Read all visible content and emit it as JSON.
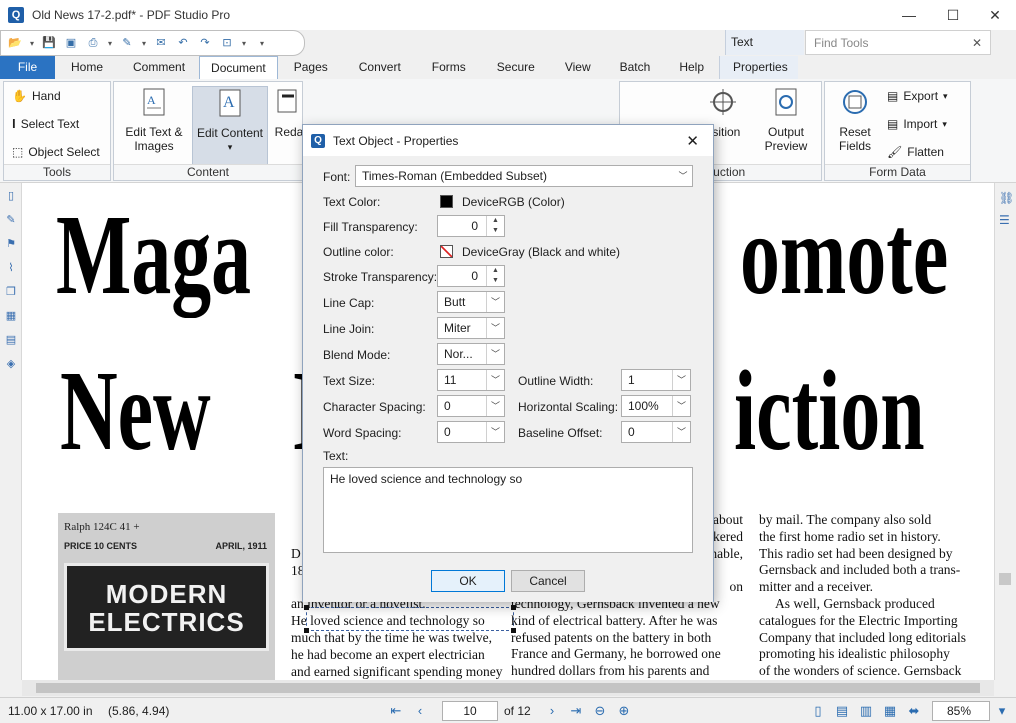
{
  "window": {
    "title": "Old News 17-2.pdf* - PDF Studio Pro",
    "logo_letter": "Q",
    "minimize": "—",
    "maximize": "☐",
    "close": "✕"
  },
  "context_tab_header": "Text",
  "find_tools": {
    "placeholder": "Find Tools",
    "clear": "✕"
  },
  "tabs": [
    "File",
    "Home",
    "Comment",
    "Document",
    "Pages",
    "Convert",
    "Forms",
    "Secure",
    "View",
    "Batch",
    "Help",
    "Properties"
  ],
  "active_tab": "Document",
  "ribbon": {
    "tools": {
      "label": "Tools",
      "items": [
        "Hand",
        "Select Text",
        "Object Select"
      ]
    },
    "content": {
      "label": "Content",
      "edit_text_images": "Edit Text &\nImages",
      "edit_content": "Edit Content",
      "redact": "Reda"
    },
    "production": {
      "label": "roduction",
      "position": "osition",
      "output_preview": "Output\nPreview"
    },
    "form_data": {
      "label": "Form Data",
      "reset_fields": "Reset\nFields",
      "export": "Export",
      "import": "Import",
      "flatten": "Flatten"
    }
  },
  "document": {
    "headline1_left": "Maga",
    "headline1_right": "omote",
    "headline2_left": "New",
    "headline2_mid": "I",
    "headline2_right": "iction",
    "photo": {
      "line1": "Ralph 124C 41 +",
      "line2": "PRICE 10 CENTS",
      "line3": "APRIL, 1911",
      "banner": "MODERN\nELECTRICS"
    },
    "col1_lines": [
      "D",
      "18",
      "",
      "an inventor or a novelist.",
      "He loved science and technology so",
      "much that by the time he was twelve,",
      "he had become an expert electrician",
      "and earned significant spending money"
    ],
    "col2_lines": [
      "about",
      "kered",
      "nable,",
      "",
      "on",
      "technology, Gernsback invented a new",
      "kind of electrical battery. After he was",
      "refused patents on the battery in both",
      "France and Germany, he borrowed one",
      "hundred dollars from his parents and"
    ],
    "col3_lines": [
      "by mail. The company also sold",
      "the first home radio set in history.",
      "This radio set had been designed by",
      "Gernsback and included both a trans-",
      "mitter and a receiver.",
      "As well, Gernsback produced",
      "catalogues for the Electric Importing",
      "Company that included long editorials",
      "promoting his idealistic philosophy",
      "of the wonders of science. Gernsback"
    ]
  },
  "status": {
    "page_size": "11.00 x 17.00 in",
    "coords": "(5.86, 4.94)",
    "current_page": "10",
    "of_pages": "of 12",
    "zoom": "85%"
  },
  "dialog": {
    "title": "Text Object - Properties",
    "font_label": "Font:",
    "font_value": "Times-Roman (Embedded Subset)",
    "text_color_label": "Text Color:",
    "text_color_value": "DeviceRGB (Color)",
    "text_color_hex": "#000000",
    "fill_transparency_label": "Fill Transparency:",
    "fill_transparency_value": "0",
    "outline_color_label": "Outline color:",
    "outline_color_value": "DeviceGray (Black and white)",
    "stroke_transparency_label": "Stroke Transparency:",
    "stroke_transparency_value": "0",
    "line_cap_label": "Line Cap:",
    "line_cap_value": "Butt",
    "line_join_label": "Line Join:",
    "line_join_value": "Miter",
    "blend_mode_label": "Blend Mode:",
    "blend_mode_value": "Nor...",
    "text_size_label": "Text Size:",
    "text_size_value": "11",
    "outline_width_label": "Outline Width:",
    "outline_width_value": "1",
    "char_spacing_label": "Character Spacing:",
    "char_spacing_value": "0",
    "horiz_scaling_label": "Horizontal Scaling:",
    "horiz_scaling_value": "100%",
    "word_spacing_label": "Word Spacing:",
    "word_spacing_value": "0",
    "baseline_offset_label": "Baseline Offset:",
    "baseline_offset_value": "0",
    "text_label": "Text:",
    "text_value": "He loved science and technology so",
    "ok": "OK",
    "cancel": "Cancel"
  }
}
